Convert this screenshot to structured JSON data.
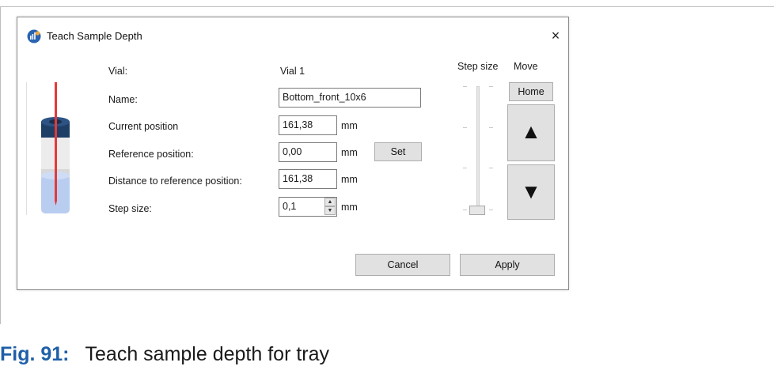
{
  "dialog": {
    "title": "Teach Sample Depth",
    "close_symbol": "×",
    "fields": {
      "vial_label": "Vial:",
      "vial_value": "Vial 1",
      "name_label": "Name:",
      "name_value": "Bottom_front_10x6",
      "current_label": "Current position",
      "current_value": "161,38",
      "current_unit": "mm",
      "reference_label": "Reference position:",
      "reference_value": "0,00",
      "reference_unit": "mm",
      "set_button": "Set",
      "distance_label": "Distance to reference position:",
      "distance_value": "161,38",
      "distance_unit": "mm",
      "step_label": "Step size:",
      "step_value": "0,1",
      "step_unit": "mm"
    },
    "step_size_header": "Step size",
    "step_slider_level": 0,
    "move_header": "Move",
    "home_button": "Home",
    "up_arrow": "▲",
    "down_arrow": "▼",
    "cancel_button": "Cancel",
    "apply_button": "Apply",
    "colors": {
      "needle": "#e23a3a",
      "vial_cap": "#1f3e66",
      "liquid": "#b9cdf0",
      "caption_accent": "#1f5fa8"
    }
  },
  "caption": {
    "figure": "Fig. 91:",
    "text": "Teach sample depth for tray"
  }
}
